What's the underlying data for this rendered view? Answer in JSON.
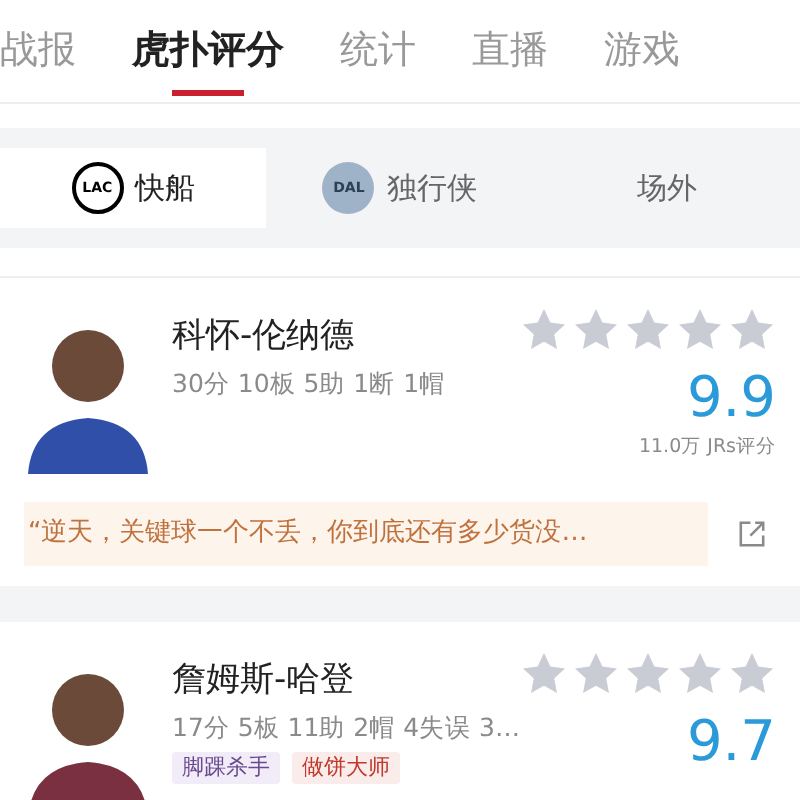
{
  "tabs": [
    {
      "label": "战报",
      "selected": false
    },
    {
      "label": "虎扑评分",
      "selected": true
    },
    {
      "label": "统计",
      "selected": false
    },
    {
      "label": "直播",
      "selected": false
    },
    {
      "label": "游戏",
      "selected": false
    }
  ],
  "team_tabs": [
    {
      "label": "快船",
      "logo": "LAC",
      "selected": true
    },
    {
      "label": "独行侠",
      "logo": "DAL",
      "selected": false
    },
    {
      "label": "场外",
      "selected": false
    }
  ],
  "players": [
    {
      "name": "科怀-伦纳德",
      "stats": "30分 10板 5助 1断 1帽",
      "stars": 0,
      "rating": "9.9",
      "votes": "11.0万 JRs评分",
      "quote": "“逆天，关键球一个不丢，你到底还有多少货没…"
    },
    {
      "name": "詹姆斯-哈登",
      "stats": "17分 5板 11助 2帽 4失误 3…",
      "stars": 0,
      "rating": "9.7",
      "tags": [
        {
          "label": "脚踝杀手",
          "kind": "purple"
        },
        {
          "label": "做饼大师",
          "kind": "red"
        }
      ]
    }
  ]
}
